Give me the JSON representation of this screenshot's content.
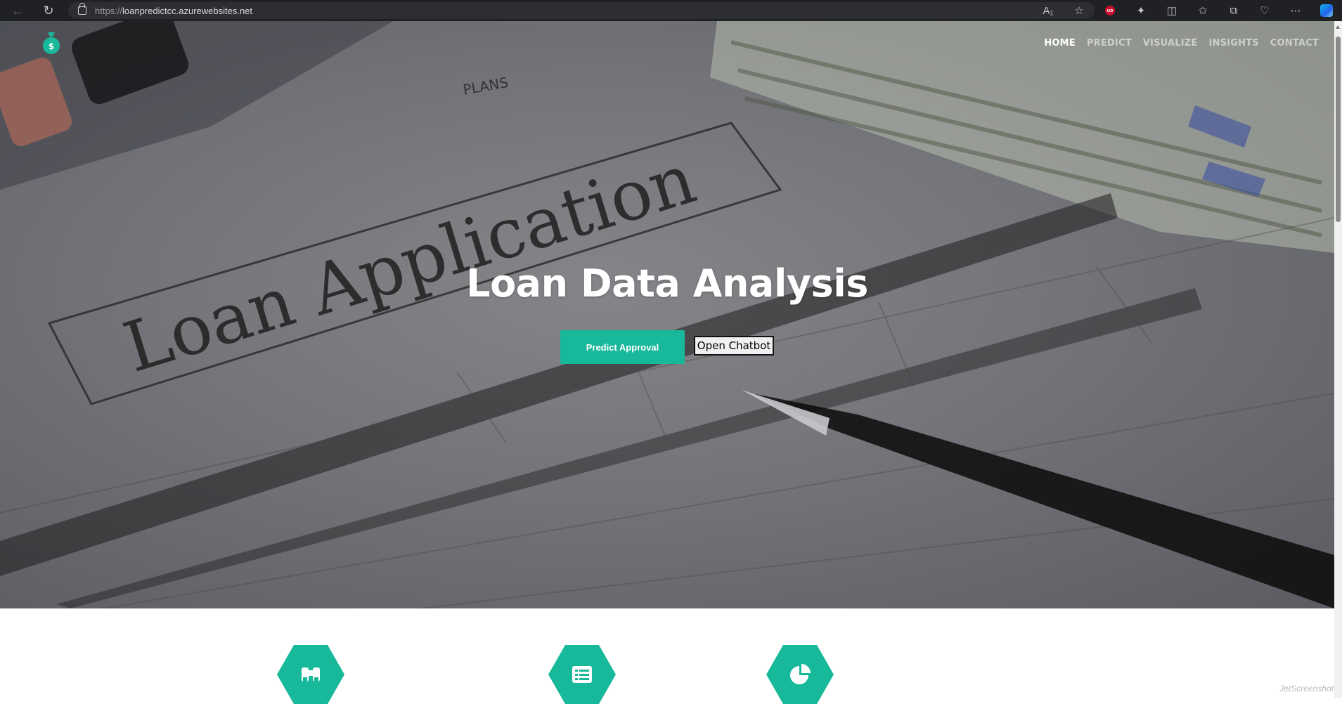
{
  "browser": {
    "url_protocol": "https://",
    "url_host": "loanpredictcc.azurewebsites.net",
    "icons": [
      "back-icon",
      "refresh-icon",
      "lock-icon",
      "read-aloud-icon",
      "favorite-star-icon",
      "ublock-icon",
      "extensions-icon",
      "split-screen-icon",
      "favorites-icon",
      "collections-icon",
      "browser-essentials-icon",
      "more-icon",
      "copilot-icon"
    ]
  },
  "nav": {
    "home": "HOME",
    "predict": "PREDICT",
    "visualize": "VISUALIZE",
    "insights": "INSIGHTS",
    "contact": "CONTACT"
  },
  "hero": {
    "title": "Loan Data Analysis",
    "predict_button": "Predict Approval",
    "chatbot_button": "Open Chatbot",
    "background_words": [
      "Loan Application",
      "PLANS"
    ]
  },
  "features": {
    "icons": [
      "binoculars-icon",
      "list-icon",
      "pie-chart-icon"
    ]
  },
  "watermark": "JetScreenshot",
  "colors": {
    "accent": "#18b89a",
    "chrome": "#202124",
    "nav_active": "#ffffff"
  }
}
